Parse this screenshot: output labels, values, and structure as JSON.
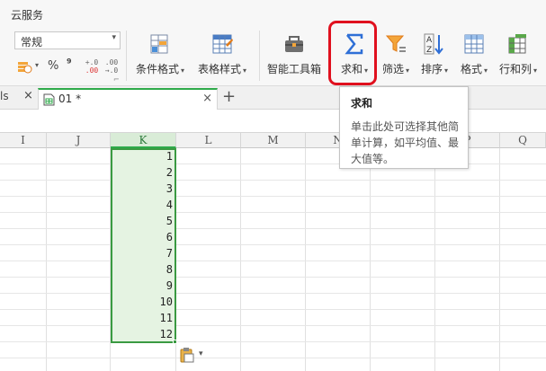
{
  "titlebar": {
    "cloud_label": "云服务"
  },
  "ribbon": {
    "font_name": "常规",
    "percent": "%",
    "comma": "⁹",
    "inc_decimal": {
      "top": "+.0",
      "bottom": ".00"
    },
    "dec_decimal": {
      "top": ".00",
      "bottom": "→.0"
    },
    "buttons": [
      {
        "id": "conditional-format",
        "label": "条件格式"
      },
      {
        "id": "table-style",
        "label": "表格样式"
      },
      {
        "id": "smart-toolbox",
        "label": "智能工具箱"
      },
      {
        "id": "sum",
        "label": "求和"
      },
      {
        "id": "filter",
        "label": "筛选"
      },
      {
        "id": "sort",
        "label": "排序"
      },
      {
        "id": "format",
        "label": "格式"
      },
      {
        "id": "row-col",
        "label": "行和列"
      }
    ],
    "dropdown_glyph": "▾",
    "corner_glyph": "⌐"
  },
  "tabs": {
    "previous_label": "ls",
    "active_label": "01 *",
    "close_glyph": "×",
    "add_glyph": "+"
  },
  "tooltip": {
    "title": "求和",
    "body": "单击此处可选择其他简单计算，如平均值、最大值等。"
  },
  "columns": [
    "I",
    "J",
    "K",
    "L",
    "M",
    "N",
    "O",
    "P",
    "Q"
  ],
  "selected_column": "K",
  "cells": [
    "1",
    "2",
    "3",
    "4",
    "5",
    "6",
    "7",
    "8",
    "9",
    "10",
    "11",
    "12"
  ],
  "colors": {
    "accent_green": "#2eaa4a",
    "highlight_red": "#e0101e",
    "selection_fill": "#e5f3e2"
  }
}
